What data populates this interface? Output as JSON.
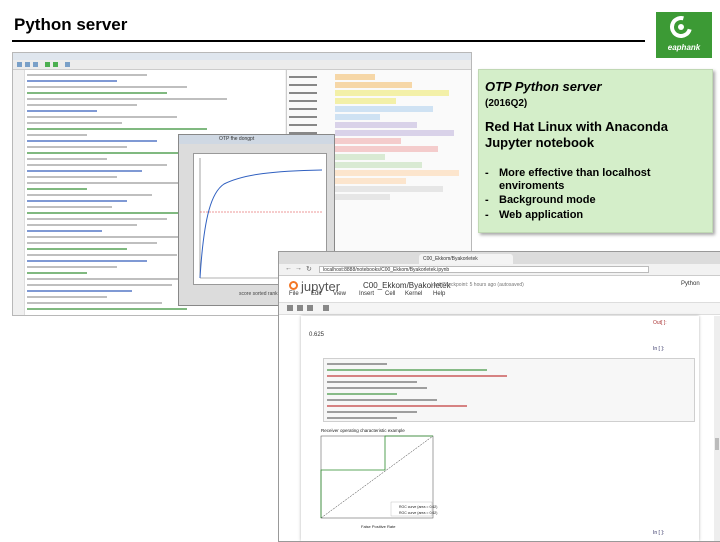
{
  "slide": {
    "title": "Python server",
    "logo_text": "eaphank"
  },
  "callout": {
    "heading": "OTP Python server",
    "date": "(2016Q2)",
    "platform": "Red Hat Linux with Anaconda Jupyter notebook",
    "bullets": [
      "More effective than localhost enviroments",
      "Background mode",
      "Web application"
    ],
    "colors": {
      "fill": "#d4eec9"
    }
  },
  "ide": {
    "plot_window_title": "OTP fhe dongpt",
    "plot_xlabel": "score sorted rank"
  },
  "browser": {
    "tab_label": "C00_Ekkom/Byakorletek",
    "url": "localhost:8888/notebooks/C00_Ekkom/Byakorletek.ipynb",
    "jupyter_wordmark": "jupyter",
    "notebook_name": "C00_Ekkom/Byakorletek",
    "checkpoint": "Last Checkpoint: 5 hours ago (autosaved)",
    "kernel": "Python",
    "menu": [
      "File",
      "Edit",
      "View",
      "Insert",
      "Cell",
      "Kernel",
      "Help"
    ],
    "cells": {
      "out_prompt_1": "Out[ ]:",
      "out_value": "0.625",
      "in_prompt_2": "In [ ]:",
      "in_prompt_3": "In [ ]:",
      "plot_title": "Receiver operating characteristic example",
      "legend": [
        "ROC curve (area = 0.62)",
        "ROC curve (area = 0.62)"
      ],
      "xlabel": "False Positive Rate"
    },
    "accent": "#f37726"
  }
}
